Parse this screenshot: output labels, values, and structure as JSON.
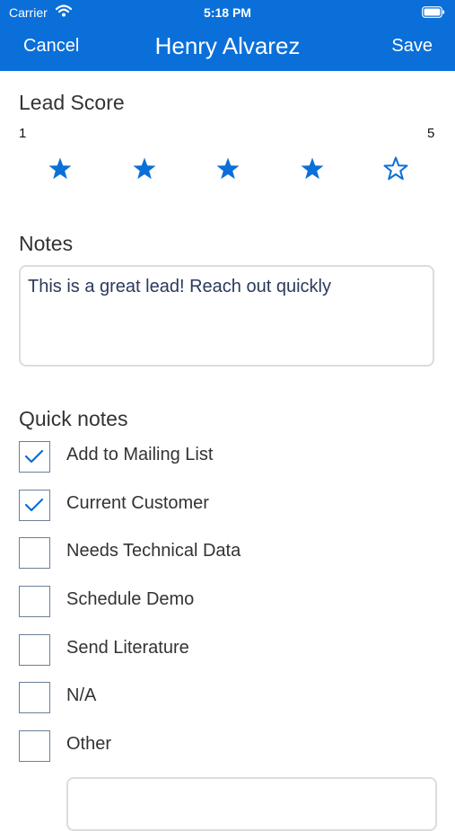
{
  "status_bar": {
    "carrier": "Carrier",
    "time": "5:18 PM"
  },
  "nav": {
    "cancel_label": "Cancel",
    "title": "Henry Alvarez",
    "save_label": "Save"
  },
  "lead_score": {
    "label": "Lead Score",
    "min_label": "1",
    "max_label": "5",
    "rating": 4,
    "max": 5
  },
  "notes": {
    "label": "Notes",
    "value": "This is a great lead! Reach out quickly"
  },
  "quick_notes": {
    "label": "Quick notes",
    "items": [
      {
        "label": "Add to Mailing List",
        "checked": true
      },
      {
        "label": "Current Customer",
        "checked": true
      },
      {
        "label": "Needs Technical Data",
        "checked": false
      },
      {
        "label": "Schedule Demo",
        "checked": false
      },
      {
        "label": "Send Literature",
        "checked": false
      },
      {
        "label": "N/A",
        "checked": false
      },
      {
        "label": "Other",
        "checked": false
      }
    ]
  },
  "colors": {
    "accent": "#0a6fd9",
    "checkbox_border": "#6b7f99",
    "field_border": "#dcdcdc"
  },
  "icons": {
    "filled_star": "filled-star-icon",
    "empty_star": "empty-star-icon",
    "checkmark": "checkmark-icon"
  }
}
